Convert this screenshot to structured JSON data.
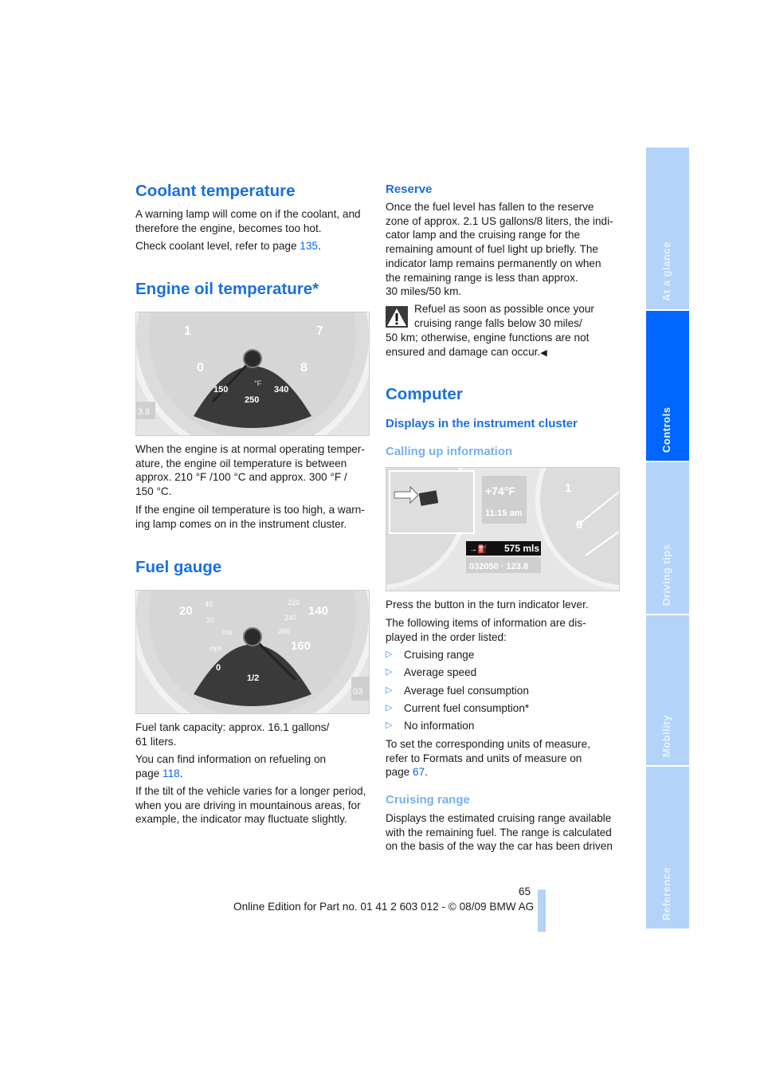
{
  "left": {
    "coolant": {
      "title": "Coolant temperature",
      "p1": "A warning lamp will come on if the coolant, and\ntherefore the engine, becomes too hot.",
      "p2_text": "Check coolant level, refer to page ",
      "p2_link": "135",
      "p2_end": "."
    },
    "engine_oil": {
      "title": "Engine oil temperature*",
      "gauge_labels": [
        "1",
        "7",
        "0",
        "8",
        "150",
        "250",
        "340",
        "°F",
        "3.8"
      ],
      "p1": "When the engine is at normal operating temper-\nature, the engine oil temperature is between\napprox. 210 °F /100 °C and approx. 300 °F /\n150 °C.",
      "p2": "If the engine oil temperature is too high, a warn-\ning lamp comes on in the instrument cluster."
    },
    "fuel": {
      "title": "Fuel gauge",
      "gauge_labels": [
        "20",
        "40",
        "20",
        "140",
        "220",
        "240",
        "260",
        "160",
        "0",
        "1/2",
        "mls",
        "mph",
        "03"
      ],
      "p1": "Fuel tank capacity: approx. 16.1 gallons/\n61 liters.",
      "p2_text": "You can find information on refueling on\npage ",
      "p2_link": "118",
      "p2_end": ".",
      "p3": "If the tilt of the vehicle varies for a longer period,\nwhen you are driving in mountainous areas, for\nexample, the indicator may fluctuate slightly."
    }
  },
  "right": {
    "reserve": {
      "title": "Reserve",
      "p1": "Once the fuel level has fallen to the reserve\nzone of approx. 2.1 US gallons/8 liters, the indi-\ncator lamp and the cruising range for the\nremaining amount of fuel light up briefly. The\nindicator lamp remains permanently on when\nthe remaining range is less than approx.\n30 miles/50 km.",
      "warning_first": "Refuel as soon as possible once your\ncruising range falls below 30 miles/",
      "warning_rest": "50 km; otherwise, engine functions are not\nensured and damage can occur.",
      "warning_icon": "warning-triangle",
      "end_mark": "◀"
    },
    "computer": {
      "title": "Computer",
      "subtitle": "Displays in the instrument cluster",
      "calling_title": "Calling up information",
      "display": {
        "temp": "+74°F",
        "time": "11:15 am",
        "range": "575 mls",
        "odometer": "032050 · 123.8",
        "gauge_digits": [
          "1",
          "0"
        ]
      },
      "p1": "Press the button in the turn indicator lever.",
      "p2": "The following items of information are dis-\nplayed in the order listed:",
      "items": [
        "Cruising range",
        "Average speed",
        "Average fuel consumption",
        "Current fuel consumption*",
        "No information"
      ],
      "bullet_icon": "▷",
      "p3_text": "To set the corresponding units of measure,\nrefer to Formats and units of measure on\npage ",
      "p3_link": "67",
      "p3_end": ".",
      "cruising_title": "Cruising range",
      "p4": "Displays the estimated cruising range available\nwith the remaining fuel. The range is calculated\non the basis of the way the car has been driven"
    }
  },
  "footer": {
    "page_number": "65",
    "edition": "Online Edition for Part no. 01 41 2 603 012 - © 08/09 BMW AG"
  },
  "side_tabs": [
    {
      "label": "At a glance",
      "active": false
    },
    {
      "label": "Controls",
      "active": true
    },
    {
      "label": "Driving tips",
      "active": false
    },
    {
      "label": "Mobility",
      "active": false
    },
    {
      "label": "Reference",
      "active": false
    }
  ],
  "colors": {
    "accent": "#1a6fe0",
    "tab_active": "#0066ff",
    "tab_inactive": "#b3d3fb",
    "subheading_light": "#7ab0ee"
  }
}
